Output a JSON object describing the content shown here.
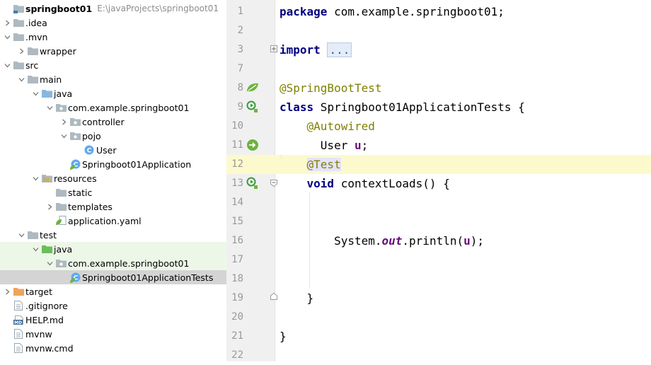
{
  "tree": {
    "root_name": "springboot01",
    "root_path": "E:\\javaProjects\\springboot01",
    "items": [
      {
        "label": "springboot01",
        "icon": "module-folder-icon"
      },
      {
        "label": ".idea",
        "icon": "folder-icon"
      },
      {
        "label": ".mvn",
        "icon": "folder-icon"
      },
      {
        "label": "wrapper",
        "icon": "folder-icon"
      },
      {
        "label": "src",
        "icon": "folder-icon"
      },
      {
        "label": "main",
        "icon": "folder-icon"
      },
      {
        "label": "java",
        "icon": "source-folder-icon"
      },
      {
        "label": "com.example.springboot01",
        "icon": "package-icon"
      },
      {
        "label": "controller",
        "icon": "package-icon"
      },
      {
        "label": "pojo",
        "icon": "package-icon"
      },
      {
        "label": "User",
        "icon": "class-icon"
      },
      {
        "label": "Springboot01Application",
        "icon": "spring-class-icon"
      },
      {
        "label": "resources",
        "icon": "resources-folder-icon"
      },
      {
        "label": "static",
        "icon": "folder-icon"
      },
      {
        "label": "templates",
        "icon": "folder-icon"
      },
      {
        "label": "application.yaml",
        "icon": "yaml-file-icon"
      },
      {
        "label": "test",
        "icon": "folder-icon"
      },
      {
        "label": "java",
        "icon": "test-source-folder-icon"
      },
      {
        "label": "com.example.springboot01",
        "icon": "package-icon"
      },
      {
        "label": "Springboot01ApplicationTests",
        "icon": "spring-class-icon"
      },
      {
        "label": "target",
        "icon": "excluded-folder-icon"
      },
      {
        "label": ".gitignore",
        "icon": "text-file-icon"
      },
      {
        "label": "HELP.md",
        "icon": "markdown-file-icon"
      },
      {
        "label": "mvnw",
        "icon": "text-file-icon"
      },
      {
        "label": "mvnw.cmd",
        "icon": "text-file-icon"
      }
    ]
  },
  "editor": {
    "line_numbers": [
      "1",
      "2",
      "3",
      "7",
      "8",
      "9",
      "10",
      "11",
      "12",
      "13",
      "14",
      "15",
      "16",
      "17",
      "18",
      "19",
      "20",
      "21",
      "22"
    ],
    "code": {
      "l1_kw": "package",
      "l1_rest": " com.example.springboot01;",
      "l3_kw": "import",
      "l3_fold": "...",
      "l8_ann": "@SpringBootTest",
      "l9_kw": "class",
      "l9_rest": " Springboot01ApplicationTests {",
      "l10_ann": "@Autowired",
      "l11_type": "User ",
      "l11_field": "u",
      "l11_end": ";",
      "l12_ann": "@Test",
      "l13_kw": "void",
      "l13_rest": " contextLoads() {",
      "l16_a": "System.",
      "l16_out": "out",
      "l16_b": ".println(",
      "l16_u": "u",
      "l16_c": ");",
      "l19_brace": "}",
      "l21_brace": "}"
    }
  },
  "colors": {
    "keyword": "#000080",
    "annotation": "#808000",
    "field": "#660e7a",
    "current_line": "#fcfacd",
    "selected_row": "#d4d4d4",
    "test_rows": "#edf7e7",
    "folder": "#aeb9c0",
    "source_folder": "#87b7e0",
    "test_folder": "#6abf5a",
    "excluded_folder": "#f0a35a",
    "spring_green": "#6db33f"
  }
}
